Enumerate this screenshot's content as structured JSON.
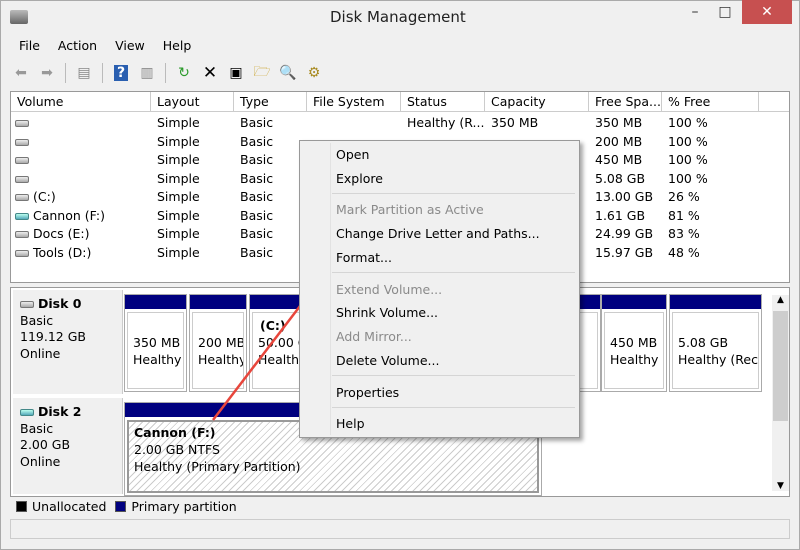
{
  "window": {
    "title": "Disk Management",
    "controls": {
      "minimize": "minimize-icon",
      "maximize": "maximize-icon",
      "close": "close-icon"
    },
    "close_color": "#c75050"
  },
  "menubar": [
    "File",
    "Action",
    "View",
    "Help"
  ],
  "toolbar": [
    "back-icon",
    "forward-icon",
    "show-hide-console-tree-icon",
    "help-icon",
    "show-hide-action-pane-icon",
    "refresh-icon",
    "delete-icon",
    "properties-icon",
    "open-icon",
    "explore-icon",
    "settings-icon"
  ],
  "volume_list": {
    "columns": [
      "Volume",
      "Layout",
      "Type",
      "File System",
      "Status",
      "Capacity",
      "Free Spa...",
      "% Free"
    ],
    "rows": [
      {
        "volume": "",
        "layout": "Simple",
        "type": "Basic",
        "fs": "",
        "status": "Healthy (R...",
        "capacity": "350 MB",
        "free": "350 MB",
        "pct": "100 %"
      },
      {
        "volume": "",
        "layout": "Simple",
        "type": "Basic",
        "fs": "",
        "status": "",
        "capacity": "",
        "free": "200 MB",
        "pct": "100 %"
      },
      {
        "volume": "",
        "layout": "Simple",
        "type": "Basic",
        "fs": "",
        "status": "",
        "capacity": "",
        "free": "450 MB",
        "pct": "100 %"
      },
      {
        "volume": "",
        "layout": "Simple",
        "type": "Basic",
        "fs": "",
        "status": "",
        "capacity": "",
        "free": "5.08 GB",
        "pct": "100 %"
      },
      {
        "volume": "(C:)",
        "layout": "Simple",
        "type": "Basic",
        "fs": "",
        "status": "",
        "capacity": "",
        "free": "13.00 GB",
        "pct": "26 %"
      },
      {
        "volume": "Cannon (F:)",
        "layout": "Simple",
        "type": "Basic",
        "fs": "",
        "status": "",
        "capacity": "",
        "free": "1.61 GB",
        "pct": "81 %",
        "usb": true
      },
      {
        "volume": "Docs (E:)",
        "layout": "Simple",
        "type": "Basic",
        "fs": "",
        "status": "",
        "capacity": "",
        "free": "24.99 GB",
        "pct": "83 %"
      },
      {
        "volume": "Tools (D:)",
        "layout": "Simple",
        "type": "Basic",
        "fs": "",
        "status": "",
        "capacity": "",
        "free": "15.97 GB",
        "pct": "48 %"
      }
    ]
  },
  "disks": [
    {
      "name": "Disk 0",
      "type": "Basic",
      "size": "119.12 GB",
      "state": "Online",
      "partitions": [
        {
          "title": "",
          "size": "350 MB",
          "status": "Healthy"
        },
        {
          "title": "",
          "size": "200 MB",
          "status": "Healthy"
        },
        {
          "title": "(C:)",
          "size": "50.00 GB",
          "status": "Healthy"
        },
        {
          "title": "",
          "size": "",
          "status": ""
        },
        {
          "title": "",
          "size": "450 MB",
          "status": "Healthy ("
        },
        {
          "title": "",
          "size": "5.08 GB",
          "status": "Healthy (Recov"
        }
      ]
    },
    {
      "name": "Disk 2",
      "type": "Basic",
      "size": "2.00 GB",
      "state": "Online",
      "partitions": [
        {
          "title": "Cannon  (F:)",
          "size": "2.00 GB NTFS",
          "status": "Healthy (Primary Partition)"
        }
      ]
    }
  ],
  "legend": [
    {
      "label": "Unallocated",
      "color": "#000000"
    },
    {
      "label": "Primary partition",
      "color": "#00007f"
    }
  ],
  "context_menu": {
    "items": [
      {
        "label": "Open",
        "enabled": true
      },
      {
        "label": "Explore",
        "enabled": true
      },
      {
        "label": "Mark Partition as Active",
        "enabled": false
      },
      {
        "label": "Change Drive Letter and Paths...",
        "enabled": true
      },
      {
        "label": "Format...",
        "enabled": true
      },
      {
        "label": "Extend Volume...",
        "enabled": false
      },
      {
        "label": "Shrink Volume...",
        "enabled": true
      },
      {
        "label": "Add Mirror...",
        "enabled": false
      },
      {
        "label": "Delete Volume...",
        "enabled": true
      },
      {
        "label": "Properties",
        "enabled": true
      },
      {
        "label": "Help",
        "enabled": true
      }
    ]
  },
  "annotation": {
    "type": "arrow",
    "color": "#e8463c"
  }
}
